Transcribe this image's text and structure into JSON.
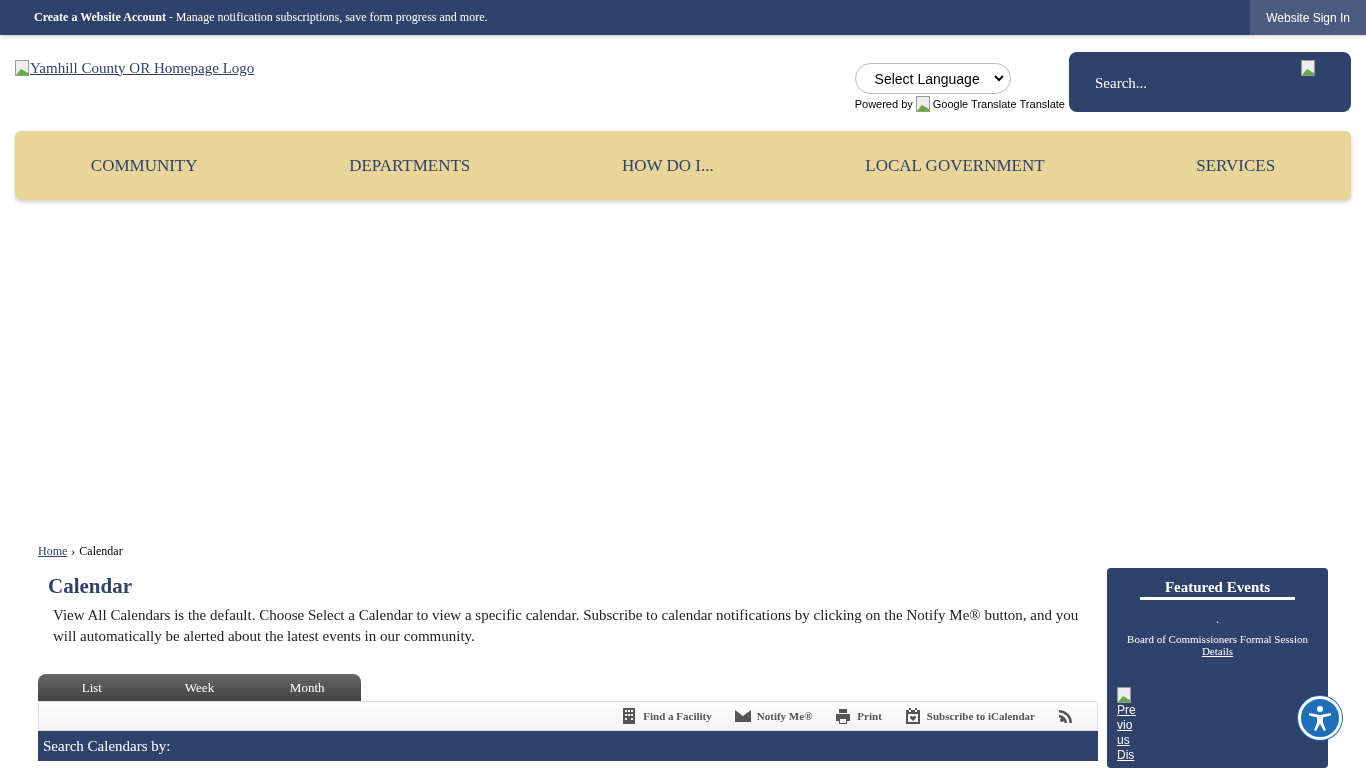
{
  "top_bar": {
    "account_text": "**Create a Website Account** - Manage notification subscriptions, save form progress and more.",
    "sign_in": "Website Sign In"
  },
  "header": {
    "logo_alt": "Yamhill County OR Homepage Logo",
    "language_select": "Select Language",
    "powered_by": "Powered by",
    "translate_alt": "Google Translate",
    "translate_label": "Translate",
    "search_placeholder": "Search..."
  },
  "nav": [
    "COMMUNITY",
    "DEPARTMENTS",
    "HOW DO I...",
    "LOCAL GOVERNMENT",
    "SERVICES"
  ],
  "breadcrumb": {
    "home": "Home",
    "separator": "›",
    "current": "Calendar"
  },
  "page_title": "Calendar",
  "intro": "View All Calendars is the default. Choose Select a Calendar to view a specific calendar. Subscribe to calendar notifications by clicking on the Notify Me® button, and you will automatically be alerted about the latest events in our community.",
  "view_tabs": [
    {
      "label": "List",
      "selected": false
    },
    {
      "label": "Week",
      "selected": false
    },
    {
      "label": "Month",
      "selected": false
    }
  ],
  "toolbar": [
    {
      "kind": "facility",
      "label": "Find a Facility"
    },
    {
      "kind": "notify",
      "label": "Notify Me®"
    },
    {
      "kind": "print",
      "label": "Print"
    },
    {
      "kind": "ical",
      "label": "Subscribe to iCalendar"
    },
    {
      "kind": "rss"
    }
  ],
  "search_bar": "Search Calendars by:",
  "featured": {
    "title": "Featured Events",
    "dot": ".",
    "event": "Board of Commissioners Formal Session",
    "details": "Details",
    "previous": "Previous Dis"
  }
}
